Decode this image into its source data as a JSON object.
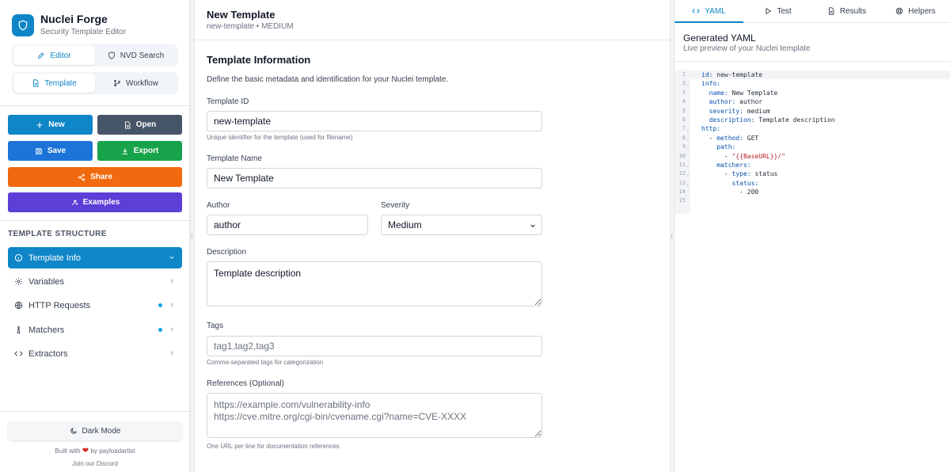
{
  "app": {
    "title": "Nuclei Forge",
    "subtitle": "Security Template Editor"
  },
  "mode_tabs": [
    {
      "label": "Editor",
      "icon": "pencil-icon"
    },
    {
      "label": "NVD Search",
      "icon": "shield-icon"
    }
  ],
  "view_tabs": [
    {
      "label": "Template",
      "icon": "file-icon"
    },
    {
      "label": "Workflow",
      "icon": "branch-icon"
    }
  ],
  "actions": {
    "new": "New",
    "open": "Open",
    "save": "Save",
    "export": "Export",
    "share": "Share",
    "examples": "Examples"
  },
  "colors": {
    "primary": "#0e86c8",
    "dark": "#475569",
    "save": "#1d74d8",
    "export": "#16a34a",
    "share": "#f26a0f",
    "examples": "#5b3fd6"
  },
  "structure": {
    "heading": "TEMPLATE STRUCTURE",
    "items": [
      {
        "label": "Template Info",
        "icon": "info-icon",
        "dot": false
      },
      {
        "label": "Variables",
        "icon": "gear-icon",
        "dot": false
      },
      {
        "label": "HTTP Requests",
        "icon": "globe-icon",
        "dot": true
      },
      {
        "label": "Matchers",
        "icon": "flask-icon",
        "dot": true
      },
      {
        "label": "Extractors",
        "icon": "code-icon",
        "dot": false
      }
    ]
  },
  "footer": {
    "dark_mode": "Dark Mode",
    "built_prefix": "Built with",
    "built_suffix": "by payloadartist",
    "discord": "Join our Discord"
  },
  "header": {
    "title": "New Template",
    "subtitle": "new-template • MEDIUM"
  },
  "form": {
    "title": "Template Information",
    "description": "Define the basic metadata and identification for your Nuclei template.",
    "template_id": {
      "label": "Template ID",
      "value": "new-template",
      "help": "Unique identifier for the template (used for filename)"
    },
    "template_name": {
      "label": "Template Name",
      "value": "New Template"
    },
    "author": {
      "label": "Author",
      "value": "author"
    },
    "severity": {
      "label": "Severity",
      "value": "Medium"
    },
    "description_field": {
      "label": "Description",
      "value": "Template description"
    },
    "tags": {
      "label": "Tags",
      "placeholder": "tag1,tag2,tag3",
      "help": "Comma-separated tags for categorization"
    },
    "references": {
      "label": "References (Optional)",
      "placeholder": "https://example.com/vulnerability-info\nhttps://cve.mitre.org/cgi-bin/cvename.cgi?name=CVE-XXXX",
      "help": "One URL per line for documentation references"
    }
  },
  "right_tabs": [
    {
      "label": "YAML",
      "icon": "code-icon"
    },
    {
      "label": "Test",
      "icon": "play-icon"
    },
    {
      "label": "Results",
      "icon": "document-icon"
    },
    {
      "label": "Helpers",
      "icon": "help-icon"
    }
  ],
  "yaml": {
    "title": "Generated YAML",
    "subtitle": "Live preview of your Nuclei template",
    "lines": [
      {
        "n": "1",
        "fold": false,
        "indent": "",
        "key": "id:",
        "val": " new-template",
        "str": ""
      },
      {
        "n": "2",
        "fold": true,
        "indent": "",
        "key": "info:",
        "val": "",
        "str": ""
      },
      {
        "n": "3",
        "fold": false,
        "indent": "  ",
        "key": "name:",
        "val": " New Template",
        "str": ""
      },
      {
        "n": "4",
        "fold": false,
        "indent": "  ",
        "key": "author:",
        "val": " author",
        "str": ""
      },
      {
        "n": "5",
        "fold": false,
        "indent": "  ",
        "key": "severity:",
        "val": " medium",
        "str": ""
      },
      {
        "n": "6",
        "fold": false,
        "indent": "  ",
        "key": "description:",
        "val": " Template description",
        "str": ""
      },
      {
        "n": "7",
        "fold": true,
        "indent": "",
        "key": "http:",
        "val": "",
        "str": ""
      },
      {
        "n": "8",
        "fold": true,
        "indent": "  - ",
        "key": "method:",
        "val": " GET",
        "str": ""
      },
      {
        "n": "9",
        "fold": true,
        "indent": "    ",
        "key": "path:",
        "val": "",
        "str": ""
      },
      {
        "n": "10",
        "fold": false,
        "indent": "      - ",
        "key": "",
        "val": "",
        "str": "\"{{BaseURL}}/\""
      },
      {
        "n": "11",
        "fold": true,
        "indent": "    ",
        "key": "matchers:",
        "val": "",
        "str": ""
      },
      {
        "n": "12",
        "fold": true,
        "indent": "      - ",
        "key": "type:",
        "val": " status",
        "str": ""
      },
      {
        "n": "13",
        "fold": true,
        "indent": "        ",
        "key": "status:",
        "val": "",
        "str": ""
      },
      {
        "n": "14",
        "fold": false,
        "indent": "          - ",
        "key": "",
        "val": "200",
        "str": ""
      },
      {
        "n": "15",
        "fold": false,
        "indent": "",
        "key": "",
        "val": "",
        "str": ""
      }
    ]
  }
}
